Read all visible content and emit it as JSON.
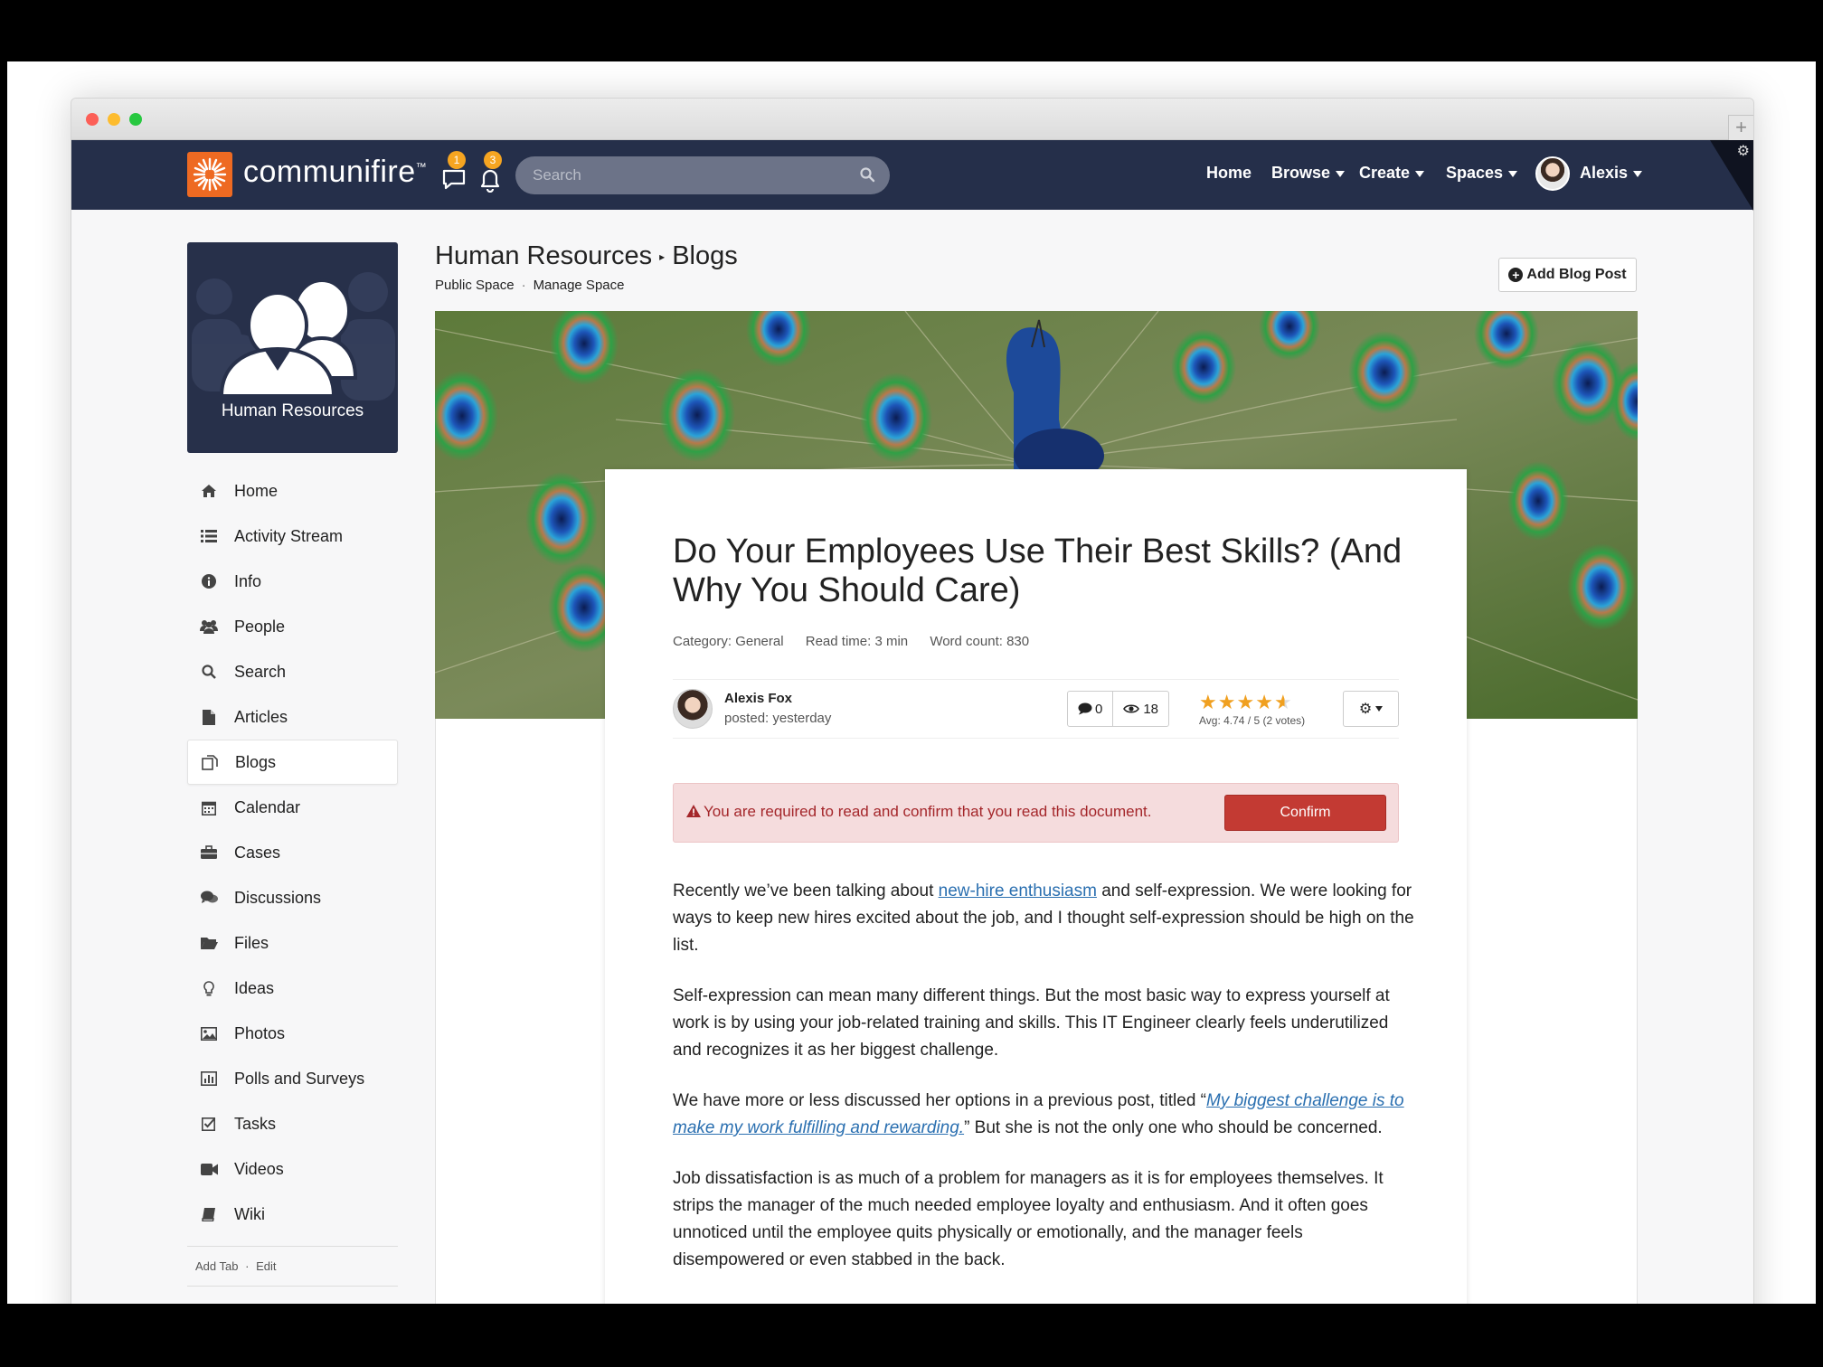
{
  "window": {
    "title": ""
  },
  "nav": {
    "brand": "communifire",
    "brand_mark": "™",
    "message_count": "1",
    "notification_count": "3",
    "search_placeholder": "Search",
    "home": "Home",
    "browse": "Browse",
    "create": "Create",
    "spaces": "Spaces",
    "user": "Alexis"
  },
  "space": {
    "name": "Human Resources",
    "breadcrumb_section": "Blogs",
    "public_space": "Public Space",
    "manage_space": "Manage Space",
    "add_post": "Add Blog Post"
  },
  "sidebar": {
    "items": [
      {
        "label": "Home",
        "icon": "home-icon"
      },
      {
        "label": "Activity Stream",
        "icon": "list-icon"
      },
      {
        "label": "Info",
        "icon": "info-icon"
      },
      {
        "label": "People",
        "icon": "people-icon"
      },
      {
        "label": "Search",
        "icon": "search-icon"
      },
      {
        "label": "Articles",
        "icon": "file-icon"
      },
      {
        "label": "Blogs",
        "icon": "blog-icon"
      },
      {
        "label": "Calendar",
        "icon": "calendar-icon"
      },
      {
        "label": "Cases",
        "icon": "briefcase-icon"
      },
      {
        "label": "Discussions",
        "icon": "comments-icon"
      },
      {
        "label": "Files",
        "icon": "folder-icon"
      },
      {
        "label": "Ideas",
        "icon": "lightbulb-icon"
      },
      {
        "label": "Photos",
        "icon": "image-icon"
      },
      {
        "label": "Polls and Surveys",
        "icon": "bar-chart-icon"
      },
      {
        "label": "Tasks",
        "icon": "checkbox-icon"
      },
      {
        "label": "Videos",
        "icon": "video-icon"
      },
      {
        "label": "Wiki",
        "icon": "book-icon"
      }
    ],
    "active": "Blogs",
    "add_tab": "Add Tab",
    "edit": "Edit"
  },
  "article": {
    "title": "Do Your Employees Use Their Best Skills? (And Why You Should Care)",
    "category": "Category: General",
    "read_time": "Read time: 3 min",
    "word_count": "Word count: 830",
    "author": "Alexis Fox",
    "posted": "posted: yesterday",
    "comments": "0",
    "views": "18",
    "rating_avg": "Avg: 4.74 / 5 (2 votes)",
    "rating_value": 4.74,
    "alert_text": "You are required to read and confirm that you read this document.",
    "confirm_label": "Confirm",
    "p1_a": "Recently we’ve been talking about ",
    "p1_link": "new-hire enthusiasm",
    "p1_b": " and self-expression. We were looking for ways to keep new hires excited about the job, and I thought self-expression should be high on the list.",
    "p2": "Self-expression can mean many different things. But the most basic way to express yourself at work is by using your job-related training and skills. This IT Engineer clearly feels underutilized and recognizes it as her biggest challenge.",
    "p3_a": "We have more or less discussed her options in a previous post, titled “",
    "p3_link": "My biggest challenge is to make my work fulfilling and rewarding.",
    "p3_b": "” But she is not the only one who should be concerned.",
    "p4": "Job dissatisfaction is as much of a problem for managers as it is for employees themselves. It strips the manager of the much needed employee loyalty and enthusiasm. And it often goes unnoticed until the employee quits physically or emotionally, and the manager feels disempowered or even stabbed in the back."
  },
  "colors": {
    "nav_bg": "#252f4a",
    "brand_orange": "#ee6a22",
    "badge": "#f6a521",
    "confirm": "#c33a33",
    "link": "#2a6fb0"
  }
}
